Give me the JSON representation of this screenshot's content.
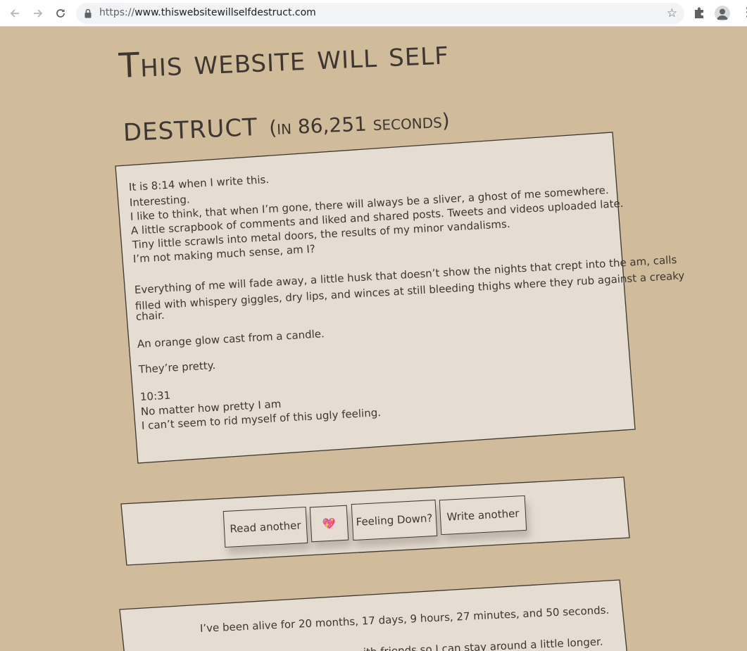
{
  "browser": {
    "url_scheme": "https://",
    "url_host": "www.thiswebsitewillselfdestruct.com"
  },
  "title": {
    "line1": "This website will self",
    "line2": "destruct",
    "countdown_prefix": "(in ",
    "countdown_value": "86,251",
    "countdown_suffix": " seconds)"
  },
  "post": {
    "lines": [
      "It is 8:14 when I write this.",
      "Interesting.",
      "I like to think, that when I’m gone, there will always be a sliver, a ghost of me somewhere.",
      "A little scrapbook of comments and liked and shared posts. Tweets and videos uploaded late.",
      "Tiny little scrawls into metal doors, the results of my minor vandalisms.",
      "I’m not making much sense, am I?",
      "Everything of me will fade away, a little husk that doesn’t show the nights that crept into the am, calls",
      "filled with whispery giggles, dry lips, and winces at still bleeding thighs where they rub against a creaky",
      "chair.",
      "An orange glow cast from a candle.",
      "They’re pretty.",
      "10:31",
      "No matter how pretty I am",
      "I can’t seem to rid myself of this ugly feeling."
    ]
  },
  "actions": {
    "read_another": "Read another",
    "heart": "💖",
    "feeling_down": "Feeling Down?",
    "write_another": "Write another"
  },
  "status": {
    "alive": "I’ve been alive for 20 months, 17 days, 9 hours, 27 minutes, and 50 seconds.",
    "friends_partial": "ith friends so I can stay around a little longer."
  }
}
